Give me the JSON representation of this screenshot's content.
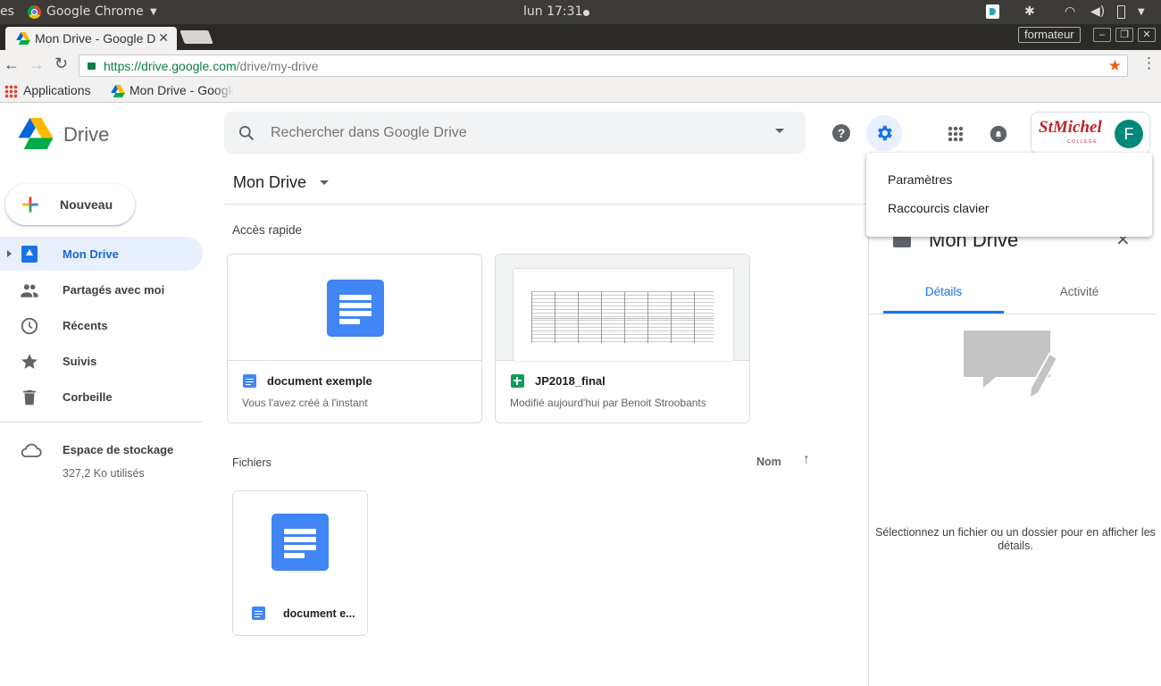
{
  "os": {
    "left_text": "es",
    "app_name": "Google Chrome",
    "clock": "lun 17:31"
  },
  "browser": {
    "tab_title": "Mon Drive - Google Drive",
    "user_name": "formateur",
    "url_scheme": "https://",
    "url_host": "drive.google.com",
    "url_path": "/drive/my-drive",
    "bookmarks": {
      "apps_label": "Applications",
      "bookmark1": "Mon Drive - Google Drive"
    }
  },
  "header": {
    "logo_text": "Drive",
    "search_placeholder": "Rechercher dans Google Drive",
    "avatar_letter": "F",
    "brand_text": "StMichel",
    "brand_sub": "COLLÈGE"
  },
  "settings_menu": {
    "items": [
      "Paramètres",
      "Raccourcis clavier"
    ]
  },
  "sidebar": {
    "new_button": "Nouveau",
    "items": [
      {
        "label": "Mon Drive",
        "icon": "drive-icon"
      },
      {
        "label": "Partagés avec moi",
        "icon": "people-icon"
      },
      {
        "label": "Récents",
        "icon": "clock-icon"
      },
      {
        "label": "Suivis",
        "icon": "star-icon"
      },
      {
        "label": "Corbeille",
        "icon": "trash-icon"
      }
    ],
    "storage_label": "Espace de stockage",
    "storage_used": "327,2 Ko utilisés"
  },
  "main": {
    "title": "Mon Drive",
    "quick_access_label": "Accès rapide",
    "quick_access": [
      {
        "name": "document exemple",
        "subtitle": "Vous l'avez créé à l'instant",
        "type": "doc"
      },
      {
        "name": "JP2018_final",
        "subtitle": "Modifié aujourd'hui par Benoit Stroobants",
        "type": "sheet"
      }
    ],
    "files_label": "Fichiers",
    "sort_label": "Nom",
    "files": [
      {
        "name": "document e..."
      }
    ]
  },
  "details_panel": {
    "title": "Mon Drive",
    "tabs": [
      "Détails",
      "Activité"
    ],
    "empty_message": "Sélectionnez un fichier ou un dossier pour en afficher les détails."
  },
  "colors": {
    "accent": "#1a73e8",
    "active_bg": "#e8f0fe",
    "doc_blue": "#4285f4",
    "sheet_green": "#0f9d58",
    "chrome_dark": "#3c3b37"
  }
}
